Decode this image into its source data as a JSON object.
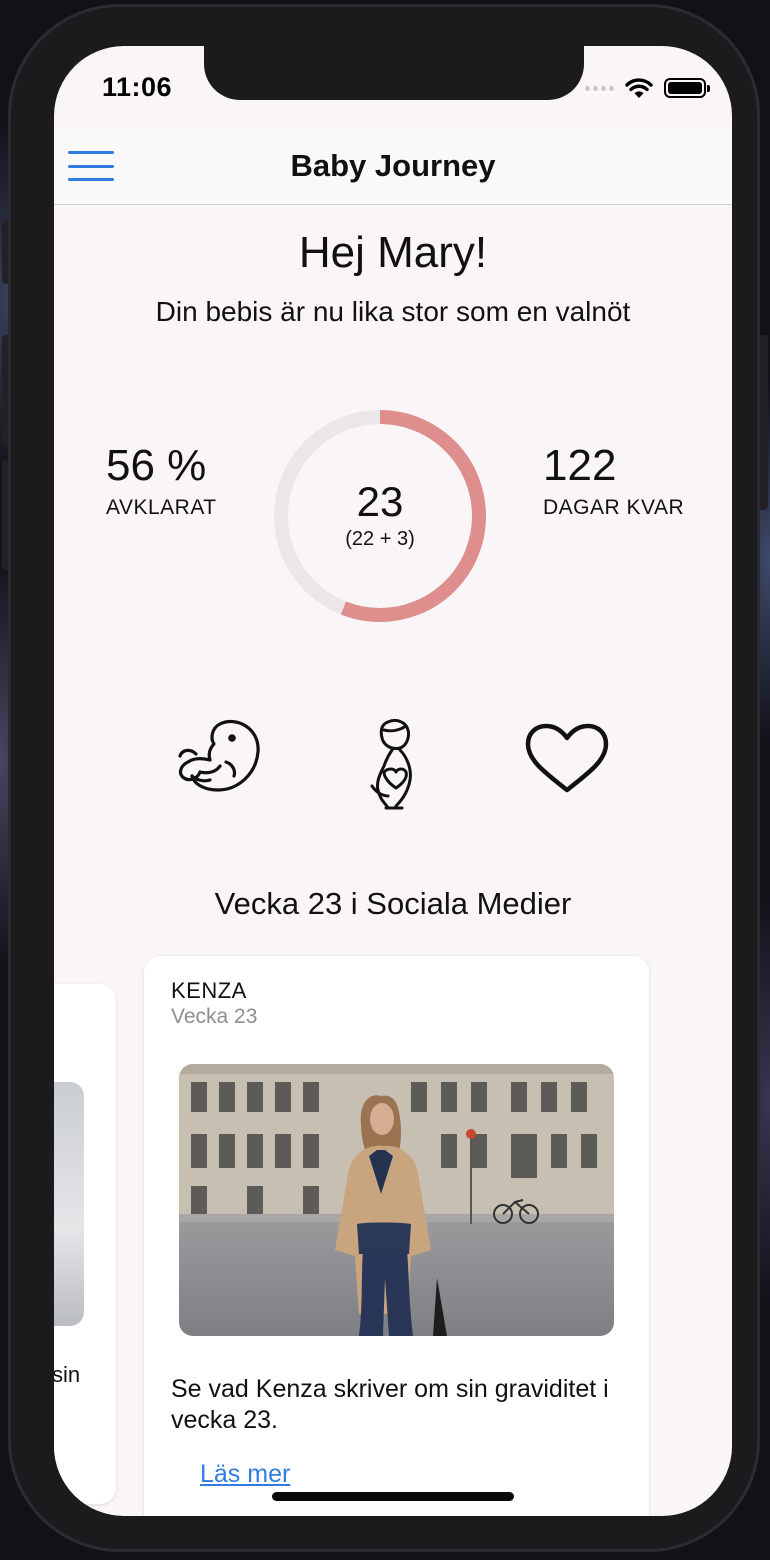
{
  "status_bar": {
    "time": "11:06"
  },
  "navbar": {
    "title": "Baby Journey"
  },
  "header": {
    "greeting": "Hej Mary!",
    "subtitle": "Din bebis är nu lika stor som en valnöt"
  },
  "progress": {
    "percent_value": "56 %",
    "percent_label": "AVKLARAT",
    "week": "23",
    "week_detail": "(22 + 3)",
    "days_value": "122",
    "days_label": "DAGAR KVAR",
    "completed_fraction": 0.56,
    "ring_color": "#de8e8c",
    "track_color": "#ebe7e8"
  },
  "icons": [
    "fetus-icon",
    "pregnant-woman-icon",
    "heart-icon"
  ],
  "social": {
    "section_title": "Vecka 23 i Sociala Medier",
    "prev_card": {
      "text_fragment": "sin"
    },
    "card": {
      "author": "KENZA",
      "week": "Vecka 23",
      "text": "Se vad Kenza skriver om sin graviditet i vecka 23.",
      "link": "Läs mer"
    }
  },
  "colors": {
    "accent": "#2f7de1",
    "background": "#faf6f7"
  }
}
